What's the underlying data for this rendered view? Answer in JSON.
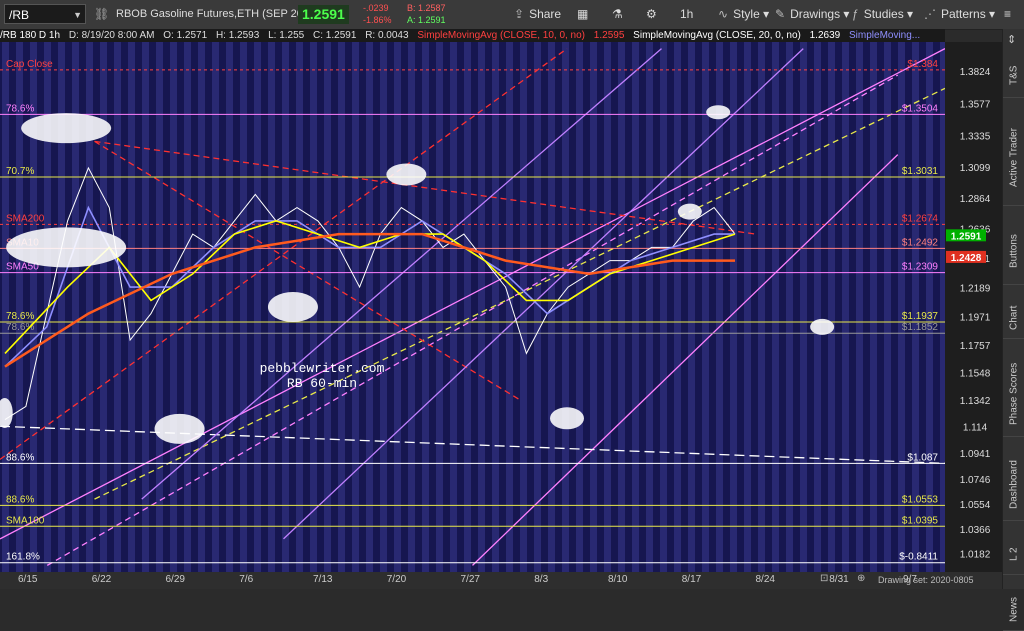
{
  "toolbar": {
    "symbol": "/RB",
    "title": "RBOB Gasoline Futures,ETH (SEP 20)",
    "last_price": "1.2591",
    "change_abs": "-.0239",
    "change_pct": "-1.86%",
    "bid": "B: 1.2587",
    "ask": "A: 1.2591",
    "share": "Share",
    "timeframe": "1h",
    "style": "Style",
    "drawings": "Drawings",
    "studies": "Studies",
    "patterns": "Patterns"
  },
  "infobar": {
    "symbol": "/RB 180 D 1h",
    "date": "D: 8/19/20 8:00 AM",
    "open": "O: 1.2571",
    "high": "H: 1.2593",
    "low": "L: 1.255",
    "close": "C: 1.2591",
    "range": "R: 0.0043",
    "sma10": "SimpleMovingAvg (CLOSE, 10, 0, no)",
    "sma10_val": "1.2595",
    "sma20": "SimpleMovingAvg (CLOSE, 20, 0, no)",
    "sma20_val": "1.2639",
    "sma_more": "SimpleMoving..."
  },
  "sidebar": [
    "T&S",
    "Active Trader",
    "Buttons",
    "Chart",
    "Phase Scores",
    "Dashboard",
    "L 2",
    "News"
  ],
  "footer": {
    "drawing_set": "Drawing set: 2020-0805"
  },
  "chart_data": {
    "type": "line",
    "watermark": [
      "pebblewriter.com",
      "RB 60-min"
    ],
    "x_ticks": [
      "6/15",
      "6/22",
      "6/29",
      "7/6",
      "7/13",
      "7/20",
      "7/27",
      "8/3",
      "8/10",
      "8/17",
      "8/24",
      "8/31",
      "9/7"
    ],
    "ylim": [
      1.005,
      1.405
    ],
    "y_ticks": [
      1.3824,
      1.3577,
      1.3335,
      1.3099,
      1.2864,
      1.2636,
      1.2411,
      1.2189,
      1.1971,
      1.1757,
      1.1548,
      1.1342,
      1.114,
      1.0941,
      1.0746,
      1.0554,
      1.0366,
      1.0182
    ],
    "series": [
      {
        "name": "price",
        "color": "#ffffff",
        "points": [
          [
            0,
            1.12
          ],
          [
            1,
            1.13
          ],
          [
            2,
            1.2
          ],
          [
            3,
            1.27
          ],
          [
            4,
            1.31
          ],
          [
            5,
            1.28
          ],
          [
            6,
            1.18
          ],
          [
            7,
            1.2
          ],
          [
            8,
            1.23
          ],
          [
            9,
            1.26
          ],
          [
            10,
            1.25
          ],
          [
            11,
            1.27
          ],
          [
            12,
            1.29
          ],
          [
            13,
            1.27
          ],
          [
            14,
            1.28
          ],
          [
            15,
            1.27
          ],
          [
            16,
            1.25
          ],
          [
            17,
            1.22
          ],
          [
            18,
            1.26
          ],
          [
            19,
            1.28
          ],
          [
            20,
            1.27
          ],
          [
            21,
            1.25
          ],
          [
            22,
            1.26
          ],
          [
            23,
            1.24
          ],
          [
            24,
            1.22
          ],
          [
            25,
            1.17
          ],
          [
            26,
            1.2
          ],
          [
            27,
            1.22
          ],
          [
            28,
            1.23
          ],
          [
            29,
            1.24
          ],
          [
            30,
            1.24
          ],
          [
            31,
            1.25
          ],
          [
            32,
            1.25
          ],
          [
            33,
            1.27
          ],
          [
            34,
            1.28
          ],
          [
            35,
            1.26
          ]
        ]
      },
      {
        "name": "SMA10",
        "color": "#8f8fff",
        "points": [
          [
            0,
            1.16
          ],
          [
            2,
            1.19
          ],
          [
            4,
            1.28
          ],
          [
            6,
            1.22
          ],
          [
            8,
            1.22
          ],
          [
            10,
            1.25
          ],
          [
            12,
            1.27
          ],
          [
            14,
            1.27
          ],
          [
            16,
            1.25
          ],
          [
            18,
            1.25
          ],
          [
            20,
            1.27
          ],
          [
            22,
            1.25
          ],
          [
            24,
            1.23
          ],
          [
            26,
            1.2
          ],
          [
            28,
            1.22
          ],
          [
            30,
            1.24
          ],
          [
            32,
            1.25
          ],
          [
            34,
            1.26
          ],
          [
            35,
            1.26
          ]
        ]
      },
      {
        "name": "SMA20",
        "color": "#ffff00",
        "points": [
          [
            0,
            1.17
          ],
          [
            3,
            1.22
          ],
          [
            5,
            1.25
          ],
          [
            7,
            1.21
          ],
          [
            9,
            1.23
          ],
          [
            11,
            1.26
          ],
          [
            13,
            1.27
          ],
          [
            15,
            1.26
          ],
          [
            17,
            1.25
          ],
          [
            19,
            1.26
          ],
          [
            21,
            1.26
          ],
          [
            23,
            1.24
          ],
          [
            25,
            1.21
          ],
          [
            27,
            1.21
          ],
          [
            29,
            1.23
          ],
          [
            31,
            1.24
          ],
          [
            33,
            1.25
          ],
          [
            35,
            1.26
          ]
        ]
      },
      {
        "name": "SMA50",
        "color": "#ff5a1e",
        "points": [
          [
            0,
            1.16
          ],
          [
            4,
            1.2
          ],
          [
            8,
            1.23
          ],
          [
            12,
            1.25
          ],
          [
            16,
            1.26
          ],
          [
            20,
            1.26
          ],
          [
            24,
            1.24
          ],
          [
            28,
            1.23
          ],
          [
            32,
            1.24
          ],
          [
            35,
            1.24
          ]
        ]
      }
    ],
    "levels": [
      {
        "label": "Cap Close",
        "price_label": "$1.384",
        "value": 1.384,
        "color": "#ff4040",
        "side_label": "Cap Close"
      },
      {
        "label": "78.6%",
        "price_label": "$1.3504",
        "value": 1.3504,
        "color": "#ff80ff"
      },
      {
        "label": "70.7%",
        "price_label": "$1.3031",
        "value": 1.3031,
        "color": "#e8e84a"
      },
      {
        "label": "SMA200",
        "price_label": "$1.2674",
        "value": 1.2674,
        "color": "#ff4040"
      },
      {
        "label": "SMA10",
        "price_label": "$1.2492",
        "value": 1.2492,
        "color": "#ff8080"
      },
      {
        "label": "SMA50",
        "price_label": "$1.2309",
        "value": 1.2309,
        "color": "#ff80ff"
      },
      {
        "label": "78.6%",
        "price_label": "$1.1937",
        "value": 1.1937,
        "color": "#e8e84a"
      },
      {
        "label": "78.6%",
        "price_label": "$1.1852",
        "value": 1.1852,
        "color": "#999999"
      },
      {
        "label": "88.6%",
        "price_label": "$1.087",
        "value": 1.087,
        "color": "#ffffff"
      },
      {
        "label": "88.6%",
        "price_label": "$1.0553",
        "value": 1.0553,
        "color": "#e8e84a"
      },
      {
        "label": "SMA100",
        "price_label": "$1.0395",
        "value": 1.0395,
        "color": "#e8e84a"
      },
      {
        "label": "161.8%",
        "price_label": "$-0.8411",
        "value": 1.012,
        "color": "#ffffff"
      }
    ],
    "price_tags": [
      {
        "text": "1.2591",
        "value": 1.2591,
        "bg": "#00b000"
      },
      {
        "text": "1.2428",
        "value": 1.2428,
        "bg": "#e03020"
      }
    ],
    "colors": {
      "background": "#161650",
      "band": "#2d2d78",
      "up": "#00d000",
      "down": "#ff3030"
    }
  }
}
